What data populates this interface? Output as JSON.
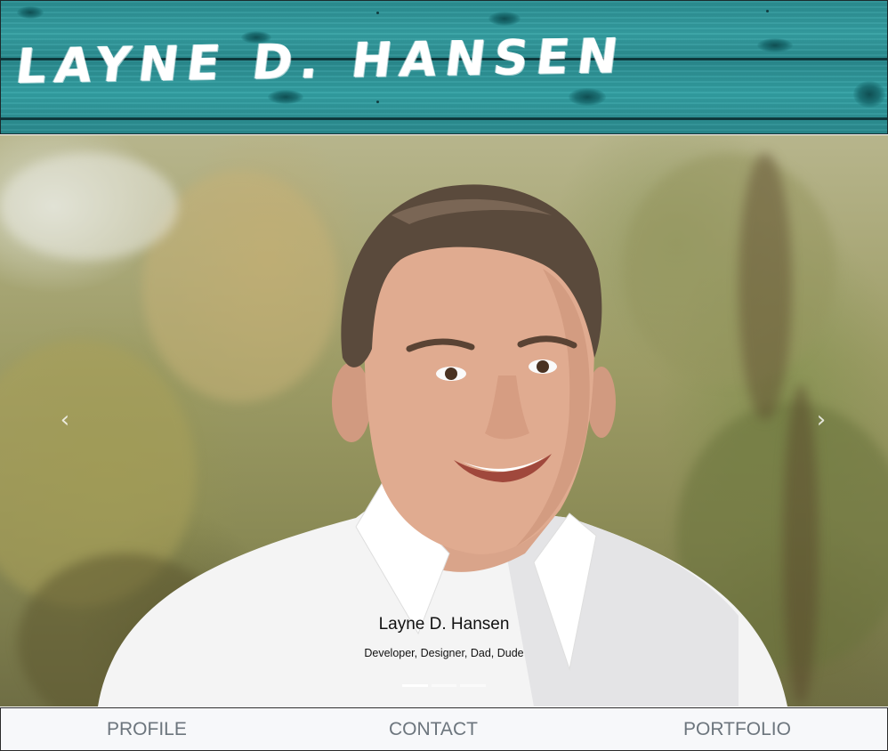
{
  "header": {
    "brand_title": "LAYNE D. HANSEN"
  },
  "carousel": {
    "prev_icon": "chevron-left-icon",
    "next_icon": "chevron-right-icon",
    "prev_glyph": "‹",
    "next_glyph": "›",
    "caption_name": "Layne D. Hansen",
    "caption_subtitle": "Developer, Designer, Dad, Dude",
    "slide_count": 3,
    "active_slide": 1
  },
  "nav": {
    "items": [
      {
        "label": "PROFILE"
      },
      {
        "label": "CONTACT"
      },
      {
        "label": "PORTFOLIO"
      }
    ]
  },
  "colors": {
    "banner_teal": "#2e9599",
    "nav_background": "#f7f8fa",
    "nav_text": "#6c757d"
  }
}
